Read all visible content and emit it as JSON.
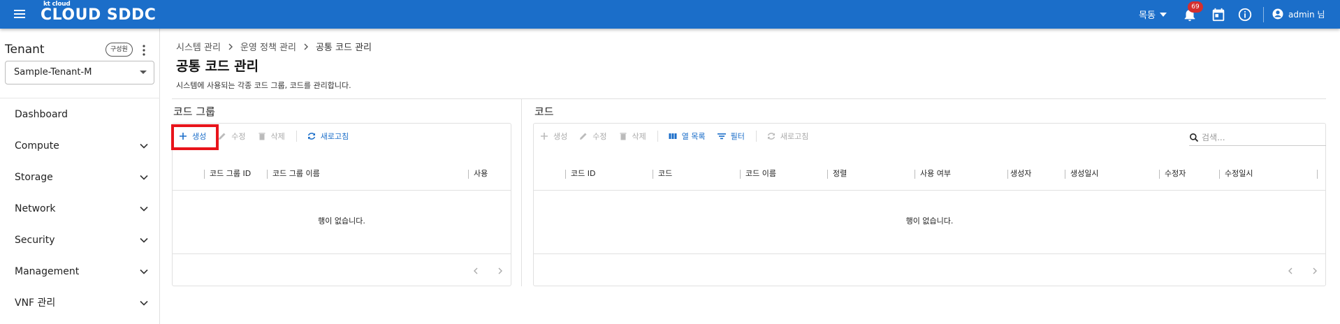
{
  "header": {
    "logo_small": "kt cloud",
    "logo_main": "CLOUD SDDC",
    "region": "목동",
    "notifications": "69",
    "user": "admin 님",
    "accent": "#1b6ec9"
  },
  "sidebar": {
    "tenant_title": "Tenant",
    "role_chip": "구성원",
    "tenant_value": "Sample-Tenant-M",
    "items": [
      {
        "label": "Dashboard"
      },
      {
        "label": "Compute"
      },
      {
        "label": "Storage"
      },
      {
        "label": "Network"
      },
      {
        "label": "Security"
      },
      {
        "label": "Management"
      },
      {
        "label": "VNF 관리"
      }
    ]
  },
  "breadcrumb": [
    "시스템 관리",
    "운영 정책 관리",
    "공통 코드 관리"
  ],
  "page": {
    "title": "공통 코드 관리",
    "description": "시스템에 사용되는 각종 코드 그룹, 코드를 관리합니다."
  },
  "group_panel": {
    "title": "코드 그룹",
    "toolbar": {
      "create": "생성",
      "edit": "수정",
      "delete": "삭제",
      "refresh": "새로고침"
    },
    "columns": [
      "코드 그룹 ID",
      "코드 그룹 이름",
      "사용"
    ],
    "empty": "행이 없습니다."
  },
  "code_panel": {
    "title": "코드",
    "toolbar": {
      "create": "생성",
      "edit": "수정",
      "delete": "삭제",
      "columns": "열 목록",
      "filter": "필터",
      "refresh": "새로고침"
    },
    "search_placeholder": "검색...",
    "columns": [
      "코드 ID",
      "코드",
      "코드 이름",
      "정렬",
      "사용 여부",
      "생성자",
      "생성일시",
      "수정자",
      "수정일시"
    ],
    "empty": "행이 없습니다."
  }
}
